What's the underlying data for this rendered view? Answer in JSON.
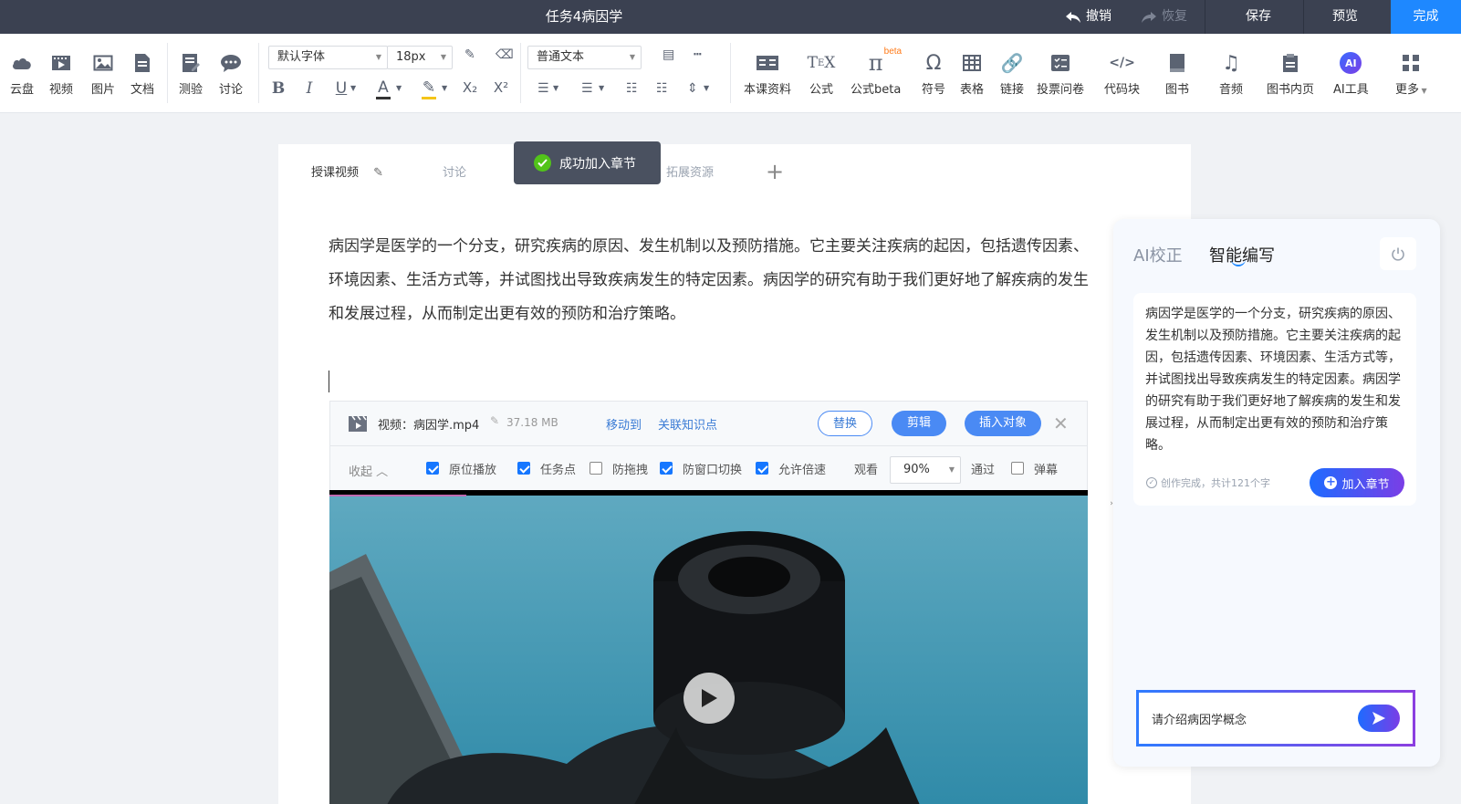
{
  "topbar": {
    "title": "任务4病因学",
    "undo": "撤销",
    "redo": "恢复",
    "save": "保存",
    "preview": "预览",
    "done": "完成"
  },
  "toolbar": {
    "groups1": [
      {
        "label": "云盘",
        "icon": "cloud-icon"
      },
      {
        "label": "视频",
        "icon": "video-icon"
      },
      {
        "label": "图片",
        "icon": "image-icon"
      },
      {
        "label": "文档",
        "icon": "document-icon"
      }
    ],
    "groups2": [
      {
        "label": "测验",
        "icon": "quiz-icon"
      },
      {
        "label": "讨论",
        "icon": "discussion-icon"
      }
    ],
    "font_family": "默认字体",
    "font_size": "18px",
    "paragraph_style": "普通文本",
    "insert": [
      {
        "label": "本课资料",
        "icon": "course-material-icon"
      },
      {
        "label": "公式",
        "icon": "formula-icon"
      },
      {
        "label": "公式beta",
        "icon": "formula-beta-icon"
      },
      {
        "label": "符号",
        "icon": "symbol-icon"
      },
      {
        "label": "表格",
        "icon": "table-icon"
      },
      {
        "label": "链接",
        "icon": "link-icon"
      },
      {
        "label": "投票问卷",
        "icon": "vote-icon"
      },
      {
        "label": "代码块",
        "icon": "code-icon"
      },
      {
        "label": "图书",
        "icon": "book-icon"
      },
      {
        "label": "音频",
        "icon": "audio-icon"
      },
      {
        "label": "图书内页",
        "icon": "book-page-icon"
      },
      {
        "label": "AI工具",
        "icon": "ai-tools-icon"
      },
      {
        "label": "更多",
        "icon": "more-icon"
      }
    ],
    "beta_badge": "beta"
  },
  "tabs": [
    {
      "label": "授课视频"
    },
    {
      "label": "讨论"
    },
    {
      "label": "拓展资源"
    }
  ],
  "toast": "成功加入章节",
  "editor": {
    "lines": [
      "病因学是医学的一个分支，研究疾病的原因、发生机制以及预防措施。它主要关注疾病的起因，包括遗传因素、",
      "环境因素、生活方式等，并试图找出导致疾病发生的特定因素。病因学的研究有助于我们更好地了解疾病的发生",
      "和发展过程，从而制定出更有效的预防和治疗策略。"
    ]
  },
  "video": {
    "name": "视频：病因学.mp4",
    "size": "37.18 MB",
    "move": "移动到",
    "link_kp": "关联知识点",
    "replace": "替换",
    "cut": "剪辑",
    "insert_obj": "插入对象",
    "collapse": "收起",
    "options": [
      {
        "label": "原位播放",
        "checked": true
      },
      {
        "label": "任务点",
        "checked": true
      },
      {
        "label": "防拖拽",
        "checked": false
      },
      {
        "label": "防窗口切换",
        "checked": true
      },
      {
        "label": "允许倍速",
        "checked": true
      }
    ],
    "watch_label": "观看",
    "watch_pct": "90%",
    "pass_label": "通过",
    "danmaku": "弹幕"
  },
  "ai_panel": {
    "tab1": "AI校正",
    "tab2": "智能编写",
    "result": "病因学是医学的一个分支，研究疾病的原因、发生机制以及预防措施。它主要关注疾病的起因，包括遗传因素、环境因素、生活方式等，并试图找出导致疾病发生的特定因素。病因学的研究有助于我们更好地了解疾病的发生和发展过程，从而制定出更有效的预防和治疗策略。",
    "status": "创作完成，共计121个字",
    "add_button": "加入章节",
    "input_value": "请介绍病因学概念"
  }
}
